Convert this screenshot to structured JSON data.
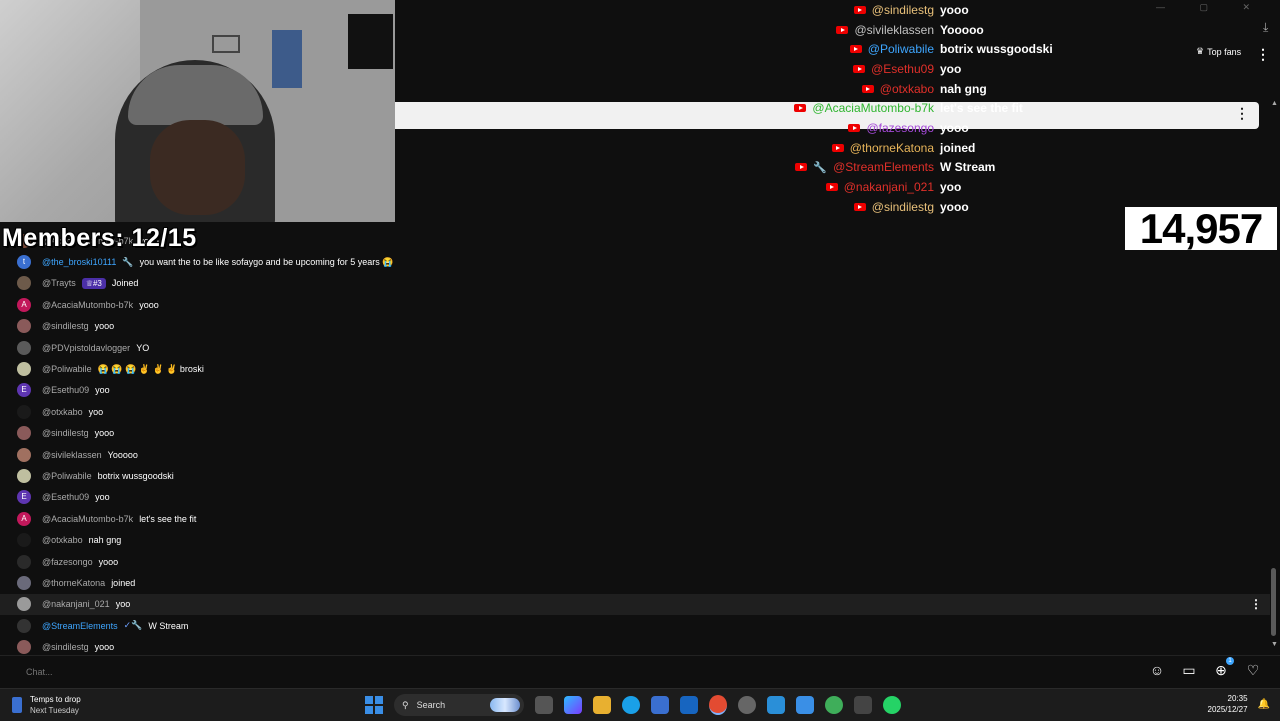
{
  "stream": {
    "members_label": "Members: 12/15",
    "viewer_count": "14,957"
  },
  "overlay_chat": [
    {
      "author": "@sindilestg",
      "message": "yooo",
      "color": "#e8c07a",
      "badges": [
        "youtube"
      ]
    },
    {
      "author": "@sivileklassen",
      "message": "Yooooo",
      "color": "#c2c2c2",
      "badges": [
        "youtube"
      ]
    },
    {
      "author": "@Poliwabile",
      "message": "botrix wussgoodski",
      "color": "#3ea6ff",
      "badges": [
        "youtube"
      ]
    },
    {
      "author": "@Esethu09",
      "message": "yoo",
      "color": "#e0302a",
      "badges": [
        "youtube"
      ]
    },
    {
      "author": "@otxkabo",
      "message": "nah gng",
      "color": "#e0302a",
      "badges": [
        "youtube"
      ]
    },
    {
      "author": "@AcaciaMutombo-b7k",
      "message": "let's see the fit",
      "color": "#2fb52f",
      "badges": [
        "youtube"
      ]
    },
    {
      "author": "@fazesongo",
      "message": "yooo",
      "color": "#a54ad8",
      "badges": [
        "youtube"
      ]
    },
    {
      "author": "@thorneKatona",
      "message": "joined",
      "color": "#e8b55a",
      "badges": [
        "youtube"
      ]
    },
    {
      "author": "@StreamElements",
      "message": "W Stream",
      "color": "#e0302a",
      "badges": [
        "youtube",
        "wrench"
      ]
    },
    {
      "author": "@nakanjani_021",
      "message": "yoo",
      "color": "#e0302a",
      "badges": [
        "youtube"
      ]
    },
    {
      "author": "@sindilestg",
      "message": "yooo",
      "color": "#e8c07a",
      "badges": [
        "youtube"
      ]
    }
  ],
  "header": {
    "top_fans_label": "Top fans"
  },
  "chat": {
    "messages": [
      {
        "author": "@AcaciaMutombo-b7k",
        "message": "yooo",
        "avatar_letter": "",
        "avatar_color": "#7a4a3a"
      },
      {
        "author": "@the_broski10111",
        "message": "you want the to be like sofaygo and be upcoming for 5 years 😭",
        "avatar_letter": "t",
        "avatar_color": "#3a6fd0",
        "author_class": "blue",
        "badge": "wrench"
      },
      {
        "author": "@Trayts",
        "message": "Joined",
        "avatar_letter": "",
        "avatar_color": "#6d5a4a",
        "rank": "♕#3"
      },
      {
        "author": "@AcaciaMutombo-b7k",
        "message": "yooo",
        "avatar_letter": "A",
        "avatar_color": "#c2185b"
      },
      {
        "author": "@sindilestg",
        "message": "yooo",
        "avatar_letter": "",
        "avatar_color": "#8a5a5a"
      },
      {
        "author": "@PDVpistoldavlogger",
        "message": "YO",
        "avatar_letter": "",
        "avatar_color": "#5a5a5a"
      },
      {
        "author": "@Poliwabile",
        "message": "😭 😭 😭 ✌️ ✌️ ✌️ broski",
        "avatar_letter": "",
        "avatar_color": "#bfbfa0"
      },
      {
        "author": "@Esethu09",
        "message": "yoo",
        "avatar_letter": "E",
        "avatar_color": "#5e35b1"
      },
      {
        "author": "@otxkabo",
        "message": "yoo",
        "avatar_letter": "",
        "avatar_color": "#1a1a1a"
      },
      {
        "author": "@sindilestg",
        "message": "yooo",
        "avatar_letter": "",
        "avatar_color": "#8a5a5a"
      },
      {
        "author": "@sivileklassen",
        "message": "Yooooo",
        "avatar_letter": "",
        "avatar_color": "#a07060"
      },
      {
        "author": "@Poliwabile",
        "message": "botrix wussgoodski",
        "avatar_letter": "",
        "avatar_color": "#bfbfa0"
      },
      {
        "author": "@Esethu09",
        "message": "yoo",
        "avatar_letter": "E",
        "avatar_color": "#5e35b1"
      },
      {
        "author": "@AcaciaMutombo-b7k",
        "message": "let's see the fit",
        "avatar_letter": "A",
        "avatar_color": "#c2185b"
      },
      {
        "author": "@otxkabo",
        "message": "nah gng",
        "avatar_letter": "",
        "avatar_color": "#1a1a1a"
      },
      {
        "author": "@fazesongo",
        "message": "yooo",
        "avatar_letter": "",
        "avatar_color": "#2a2a2a"
      },
      {
        "author": "@thorneKatona",
        "message": "joined",
        "avatar_letter": "",
        "avatar_color": "#6a6a7a"
      },
      {
        "author": "@nakanjani_021",
        "message": "yoo",
        "avatar_letter": "",
        "avatar_color": "#9a9a9a",
        "highlight": true
      },
      {
        "author": "@StreamElements",
        "message": "W Stream",
        "avatar_letter": "",
        "avatar_color": "#333",
        "author_class": "blue",
        "badge": "check-wrench"
      },
      {
        "author": "@sindilestg",
        "message": "yooo",
        "avatar_letter": "",
        "avatar_color": "#8a5a5a"
      }
    ],
    "input_placeholder": "Chat..."
  },
  "taskbar": {
    "weather_title": "Temps to drop",
    "weather_sub": "Next Tuesday",
    "search_label": "Search",
    "time": "20:35",
    "date": "2025/12/27"
  }
}
